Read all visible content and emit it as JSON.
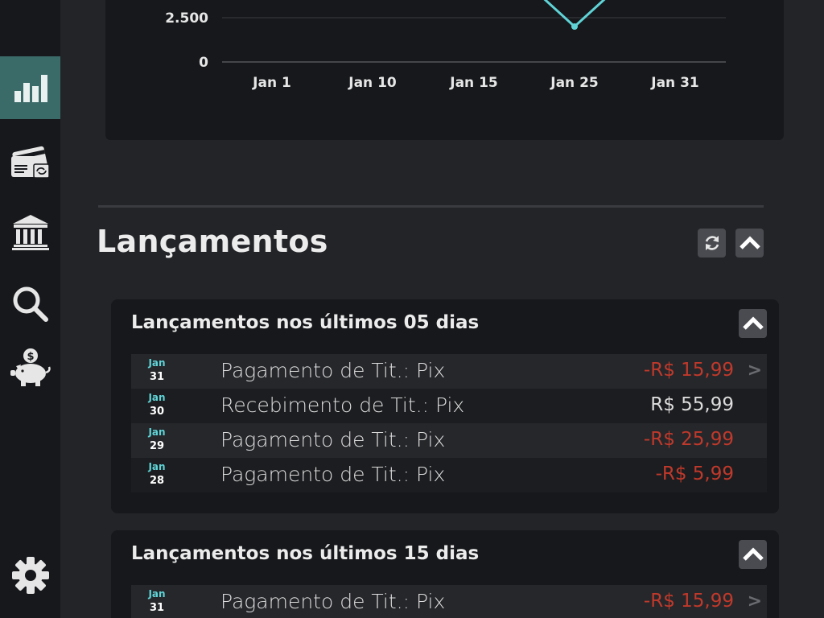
{
  "sidebar": {
    "items": [
      {
        "name": "chart",
        "icon": "bar-chart-icon",
        "active": true
      },
      {
        "name": "cards",
        "icon": "credit-card-sync-icon",
        "active": false
      },
      {
        "name": "bank",
        "icon": "bank-icon",
        "active": false
      },
      {
        "name": "search",
        "icon": "search-icon",
        "active": false
      },
      {
        "name": "savings",
        "icon": "piggy-bank-icon",
        "active": false
      }
    ],
    "settings_icon": "gear-icon"
  },
  "chart_data": {
    "type": "line",
    "y_ticks": [
      "2.500",
      "0"
    ],
    "x_ticks": [
      "Jan 1",
      "Jan 10",
      "Jan 15",
      "Jan 25",
      "Jan 31"
    ],
    "series": [
      {
        "color": "#5fd3d6",
        "points": [
          {
            "x": "Jan 22",
            "y": 3800
          },
          {
            "x": "Jan 25",
            "y": 2000
          },
          {
            "x": "Jan 28",
            "y": 3800
          }
        ]
      }
    ],
    "grid": true
  },
  "section": {
    "title": "Lançamentos",
    "refresh_icon": "refresh-icon",
    "collapse_icon": "chevron-up-icon"
  },
  "panels": [
    {
      "title": "Lançamentos nos últimos 05 dias",
      "rows": [
        {
          "month": "Jan",
          "day": "31",
          "desc": "Pagamento de Tit.: Pix",
          "amount": "-R$ 15,99",
          "negative": true,
          "chevron": ">"
        },
        {
          "month": "Jan",
          "day": "30",
          "desc": "Recebimento de Tit.: Pix",
          "amount": "R$ 55,99",
          "negative": false,
          "chevron": ""
        },
        {
          "month": "Jan",
          "day": "29",
          "desc": "Pagamento de Tit.: Pix",
          "amount": "-R$ 25,99",
          "negative": true,
          "chevron": ""
        },
        {
          "month": "Jan",
          "day": "28",
          "desc": "Pagamento de Tit.: Pix",
          "amount": "-R$ 5,99",
          "negative": true,
          "chevron": ""
        }
      ]
    },
    {
      "title": "Lançamentos nos últimos 15 dias",
      "rows": [
        {
          "month": "Jan",
          "day": "31",
          "desc": "Pagamento de Tit.: Pix",
          "amount": "-R$ 15,99",
          "negative": true,
          "chevron": ">"
        }
      ]
    }
  ],
  "colors": {
    "accent": "#5fd3d6",
    "active_nav": "#3b6b69",
    "negative": "#c0392b"
  }
}
